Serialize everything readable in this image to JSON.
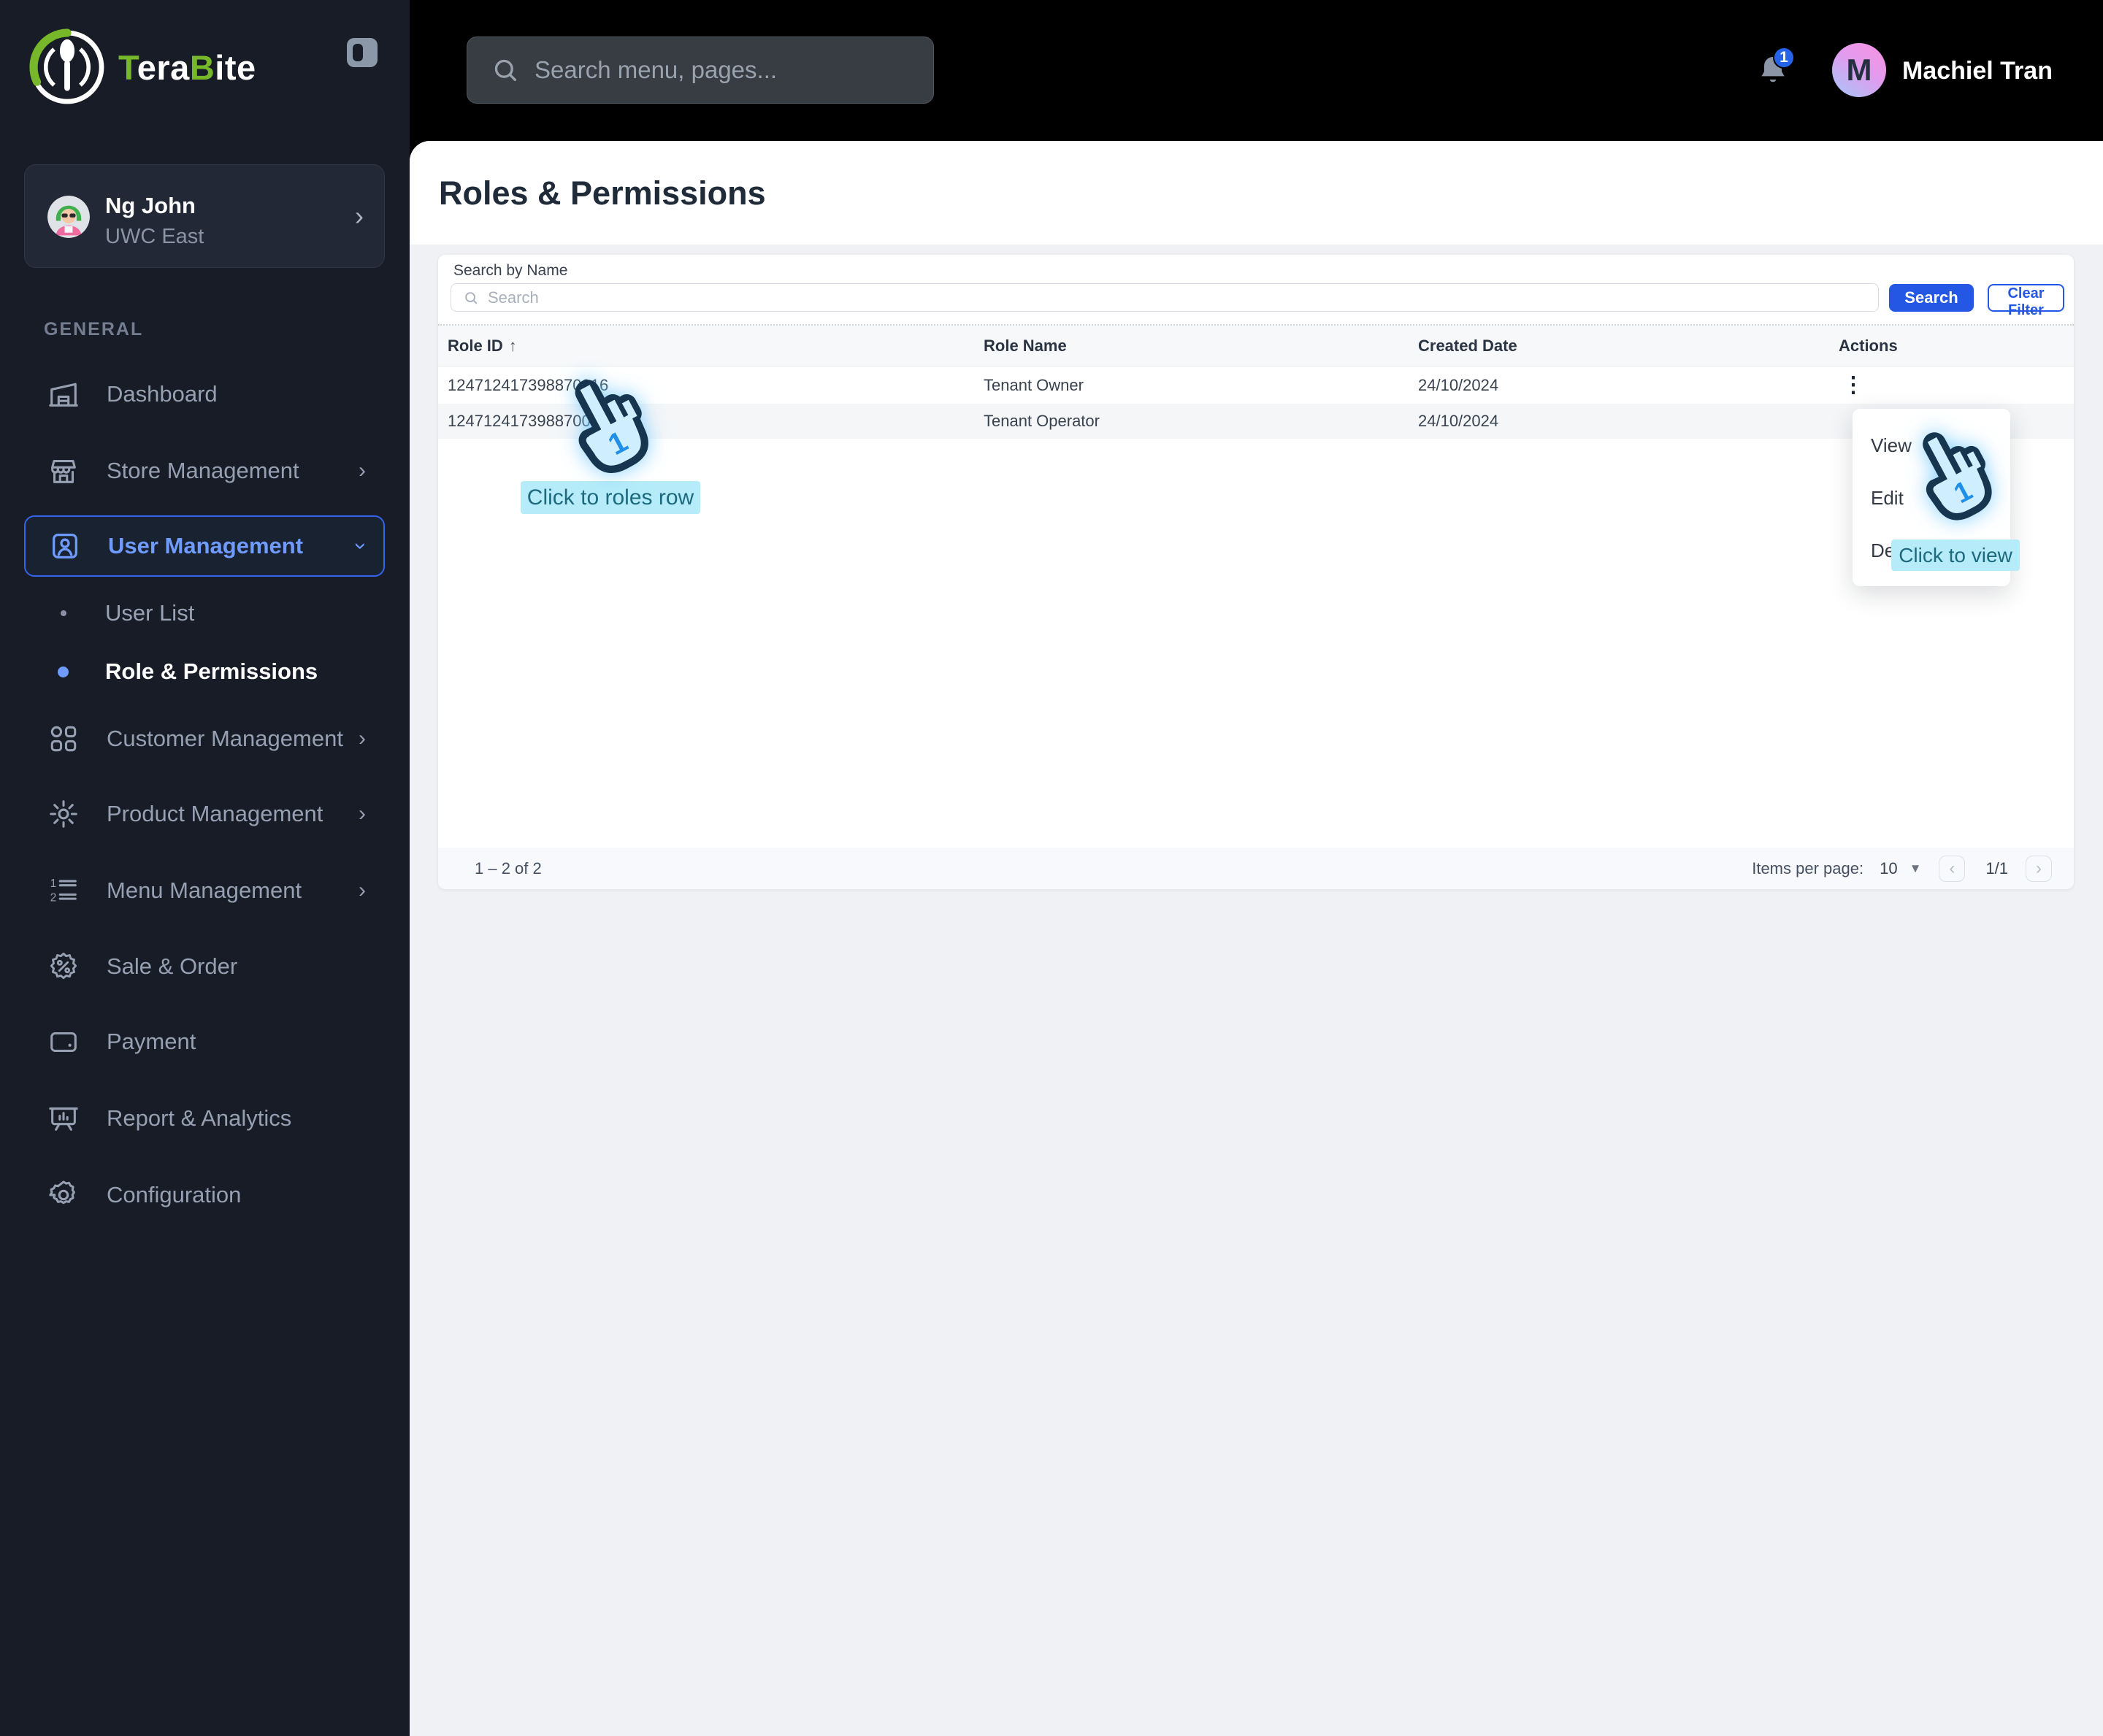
{
  "brand": {
    "t1": "T",
    "t2": "era",
    "t3": "B",
    "t4": "ite"
  },
  "profile": {
    "name": "Ng John",
    "org": "UWC East"
  },
  "sidebar": {
    "section_label": "GENERAL",
    "items": [
      {
        "label": "Dashboard"
      },
      {
        "label": "Store Management"
      },
      {
        "label": "User Management"
      },
      {
        "label": "User List"
      },
      {
        "label": "Role & Permissions"
      },
      {
        "label": "Customer Management"
      },
      {
        "label": "Product Management"
      },
      {
        "label": "Menu Management"
      },
      {
        "label": "Sale & Order"
      },
      {
        "label": "Payment"
      },
      {
        "label": "Report & Analytics"
      },
      {
        "label": "Configuration"
      }
    ]
  },
  "topbar": {
    "search_placeholder": "Search menu, pages...",
    "notification_count": "1",
    "user_initial": "M",
    "user_name": "Machiel Tran"
  },
  "page": {
    "title": "Roles & Permissions"
  },
  "filter": {
    "label": "Search by Name",
    "input_placeholder": "Search",
    "search_button": "Search",
    "clear_button": "Clear Filter"
  },
  "table": {
    "columns": [
      "Role ID",
      "Role Name",
      "Created Date",
      "Actions"
    ],
    "rows": [
      {
        "id": "124712417398870016",
        "name": "Tenant Owner",
        "date": "24/10/2024"
      },
      {
        "id": "124712417398870017",
        "name": "Tenant Operator",
        "date": "24/10/2024"
      }
    ]
  },
  "action_menu": {
    "items": [
      "View",
      "Edit",
      "Delete"
    ]
  },
  "annotations": {
    "row_hint": "Click to roles row",
    "view_hint": "Click to view"
  },
  "pagination": {
    "range": "1 – 2 of 2",
    "items_per_page_label": "Items per page:",
    "items_per_page_value": "10",
    "page_indicator": "1/1"
  },
  "icons": {
    "chevron_right": "›",
    "chevron_down": "›",
    "profile_chevron": "›",
    "sort_asc": "↑",
    "kebab": "⋮",
    "caret_down": "▼",
    "page_prev": "‹",
    "page_next": "›"
  },
  "colors": {
    "accent": "#2458e4",
    "sidebar_bg": "#171c26",
    "topbar_bg": "#000000",
    "active_item_blue": "#6f9bff",
    "logo_green": "#76b82a",
    "badge_blue": "#2563eb",
    "annotation_bg": "#b6ecf9",
    "annotation_text": "#1d6a7e"
  }
}
